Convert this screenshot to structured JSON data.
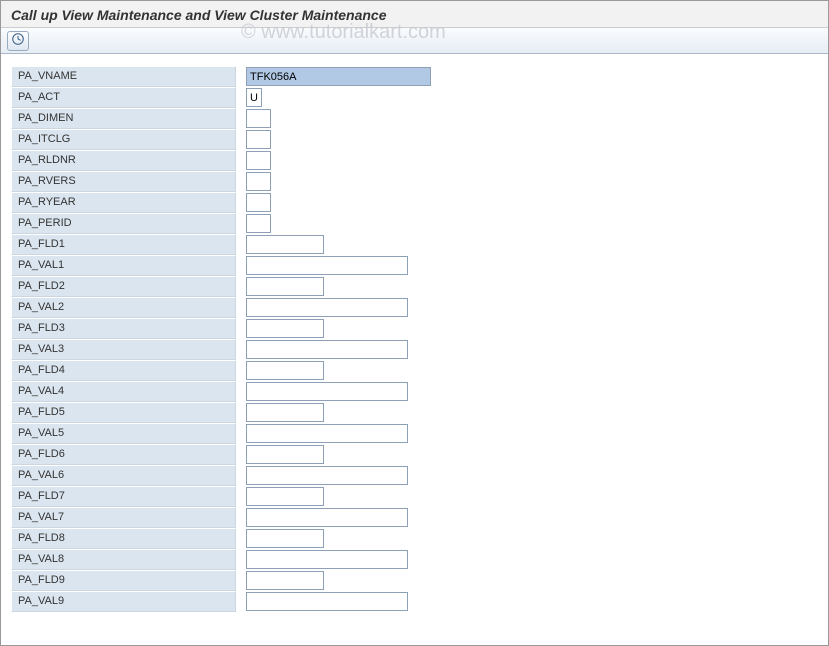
{
  "title": "Call up View Maintenance and View Cluster Maintenance",
  "watermark": "© www.tutorialkart.com",
  "toolbar": {
    "execute_tooltip": "Execute"
  },
  "fields": [
    {
      "label": "PA_VNAME",
      "value": "TFK056A",
      "width": "w-xl",
      "selected": true
    },
    {
      "label": "PA_ACT",
      "value": "U",
      "width": "w-s"
    },
    {
      "label": "PA_DIMEN",
      "value": "",
      "width": "w-sm"
    },
    {
      "label": "PA_ITCLG",
      "value": "",
      "width": "w-sm"
    },
    {
      "label": "PA_RLDNR",
      "value": "",
      "width": "w-sm"
    },
    {
      "label": "PA_RVERS",
      "value": "",
      "width": "w-sm"
    },
    {
      "label": "PA_RYEAR",
      "value": "",
      "width": "w-sm"
    },
    {
      "label": "PA_PERID",
      "value": "",
      "width": "w-sm"
    },
    {
      "label": "PA_FLD1",
      "value": "",
      "width": "w-md"
    },
    {
      "label": "PA_VAL1",
      "value": "",
      "width": "w-lg"
    },
    {
      "label": "PA_FLD2",
      "value": "",
      "width": "w-md"
    },
    {
      "label": "PA_VAL2",
      "value": "",
      "width": "w-lg"
    },
    {
      "label": "PA_FLD3",
      "value": "",
      "width": "w-md"
    },
    {
      "label": "PA_VAL3",
      "value": "",
      "width": "w-lg"
    },
    {
      "label": "PA_FLD4",
      "value": "",
      "width": "w-md"
    },
    {
      "label": "PA_VAL4",
      "value": "",
      "width": "w-lg"
    },
    {
      "label": "PA_FLD5",
      "value": "",
      "width": "w-md"
    },
    {
      "label": "PA_VAL5",
      "value": "",
      "width": "w-lg"
    },
    {
      "label": "PA_FLD6",
      "value": "",
      "width": "w-md"
    },
    {
      "label": "PA_VAL6",
      "value": "",
      "width": "w-lg"
    },
    {
      "label": "PA_FLD7",
      "value": "",
      "width": "w-md"
    },
    {
      "label": "PA_VAL7",
      "value": "",
      "width": "w-lg"
    },
    {
      "label": "PA_FLD8",
      "value": "",
      "width": "w-md"
    },
    {
      "label": "PA_VAL8",
      "value": "",
      "width": "w-lg"
    },
    {
      "label": "PA_FLD9",
      "value": "",
      "width": "w-md"
    },
    {
      "label": "PA_VAL9",
      "value": "",
      "width": "w-lg"
    }
  ]
}
